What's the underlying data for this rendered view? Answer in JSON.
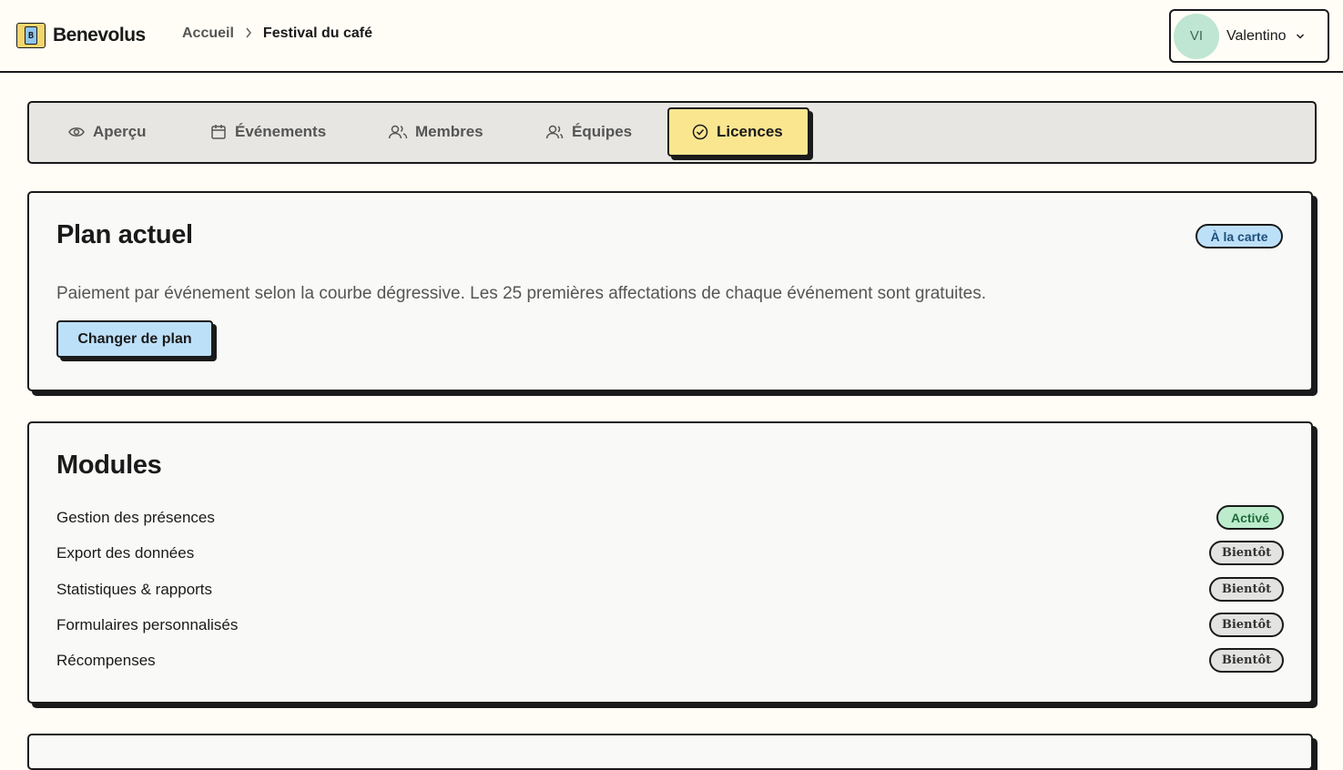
{
  "app": {
    "name": "Benevolus",
    "logo_letter": "B"
  },
  "breadcrumb": {
    "home": "Accueil",
    "current": "Festival du café"
  },
  "user": {
    "initials": "VI",
    "name": "Valentino"
  },
  "tabs": [
    {
      "label": "Aperçu",
      "icon": "eye-icon"
    },
    {
      "label": "Événements",
      "icon": "calendar-icon"
    },
    {
      "label": "Membres",
      "icon": "users-icon"
    },
    {
      "label": "Équipes",
      "icon": "team-icon"
    },
    {
      "label": "Licences",
      "icon": "check-badge-icon",
      "active": true
    }
  ],
  "plan": {
    "title": "Plan actuel",
    "badge": "À la carte",
    "description": "Paiement par événement selon la courbe dégressive. Les 25 premières affectations de chaque événement sont gratuites.",
    "change_button": "Changer de plan"
  },
  "modules": {
    "title": "Modules",
    "items": [
      {
        "label": "Gestion des présences",
        "status": "Activé"
      },
      {
        "label": "Export des données",
        "status": "Bientôt"
      },
      {
        "label": "Statistiques & rapports",
        "status": "Bientôt"
      },
      {
        "label": "Formulaires personnalisés",
        "status": "Bientôt"
      },
      {
        "label": "Récompenses",
        "status": "Bientôt"
      }
    ]
  },
  "colors": {
    "accent_yellow": "#fbe690",
    "accent_blue": "#bde0f9",
    "accent_green": "#bdeccd",
    "border": "#1a1a1a"
  }
}
